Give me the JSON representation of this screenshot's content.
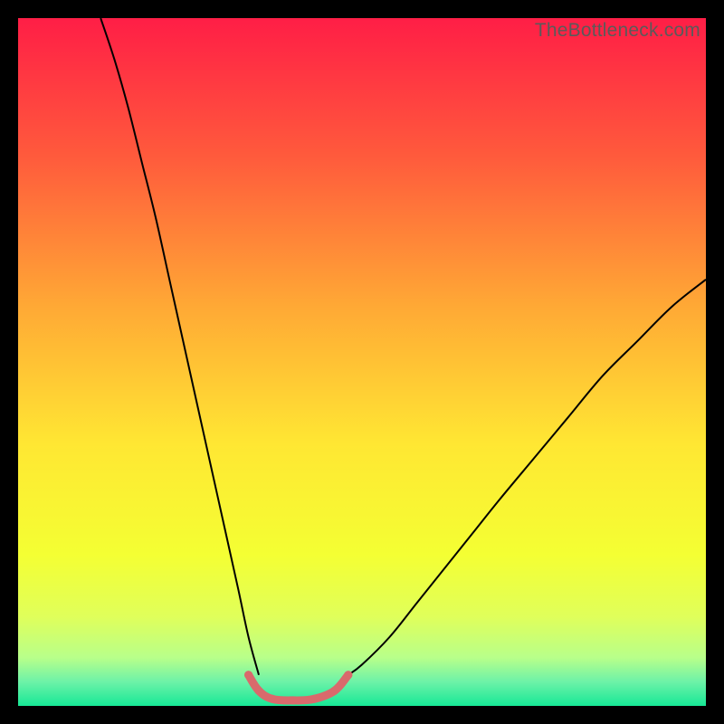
{
  "watermark": "TheBottleneck.com",
  "chart_data": {
    "type": "line",
    "title": "",
    "xlabel": "",
    "ylabel": "",
    "xlim": [
      0,
      100
    ],
    "ylim": [
      0,
      100
    ],
    "background_gradient": {
      "stops": [
        {
          "pos": 0.0,
          "color": "#ff1e46"
        },
        {
          "pos": 0.2,
          "color": "#ff5a3c"
        },
        {
          "pos": 0.42,
          "color": "#ffa935"
        },
        {
          "pos": 0.62,
          "color": "#ffe733"
        },
        {
          "pos": 0.78,
          "color": "#f4ff33"
        },
        {
          "pos": 0.87,
          "color": "#e0ff5a"
        },
        {
          "pos": 0.93,
          "color": "#b8ff8a"
        },
        {
          "pos": 0.965,
          "color": "#6df2a8"
        },
        {
          "pos": 1.0,
          "color": "#17e896"
        }
      ]
    },
    "series": [
      {
        "name": "left-curve",
        "color": "#000000",
        "width": 2,
        "x": [
          12,
          14,
          16,
          18,
          20,
          22,
          24,
          26,
          28,
          30,
          32,
          33.5,
          35
        ],
        "y": [
          100,
          94,
          87,
          79,
          71,
          62,
          53,
          44,
          35,
          26,
          17,
          10,
          4.5
        ]
      },
      {
        "name": "right-curve",
        "color": "#000000",
        "width": 2,
        "x": [
          48,
          50,
          54,
          58,
          62,
          66,
          70,
          75,
          80,
          85,
          90,
          95,
          100
        ],
        "y": [
          4.5,
          6,
          10,
          15,
          20,
          25,
          30,
          36,
          42,
          48,
          53,
          58,
          62
        ]
      },
      {
        "name": "bottom-highlight",
        "color": "#d96a6c",
        "width": 9,
        "linecap": "round",
        "x": [
          33.5,
          35,
          37,
          40,
          43,
          46,
          48
        ],
        "y": [
          4.5,
          2.2,
          1.0,
          0.8,
          1.0,
          2.2,
          4.5
        ],
        "markers": true,
        "marker_r": 4.6
      }
    ]
  }
}
